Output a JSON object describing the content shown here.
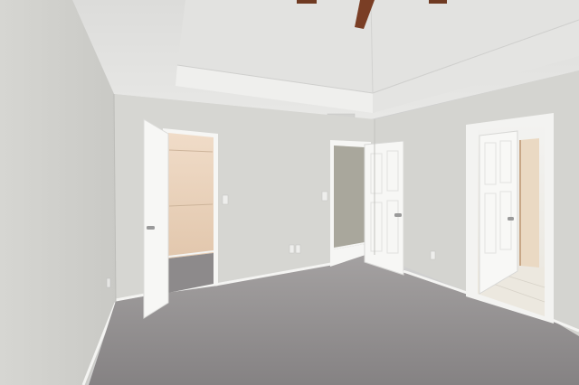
{
  "photo": {
    "subject": "empty-bedroom-interior",
    "features": [
      "tray-ceiling",
      "ceiling-fan",
      "walk-in-closet",
      "closet",
      "bathroom-doorway",
      "gray-carpet",
      "white-baseboards"
    ],
    "colors": {
      "wall": "#d8d8d4",
      "wall_shadow": "#b9b9b5",
      "ceiling": "#e6e6e4",
      "carpet": "#8d8a8b",
      "trim": "#f4f4f2",
      "closet_light": "#e9d3bd",
      "fan_blade": "#7a3e25"
    }
  }
}
